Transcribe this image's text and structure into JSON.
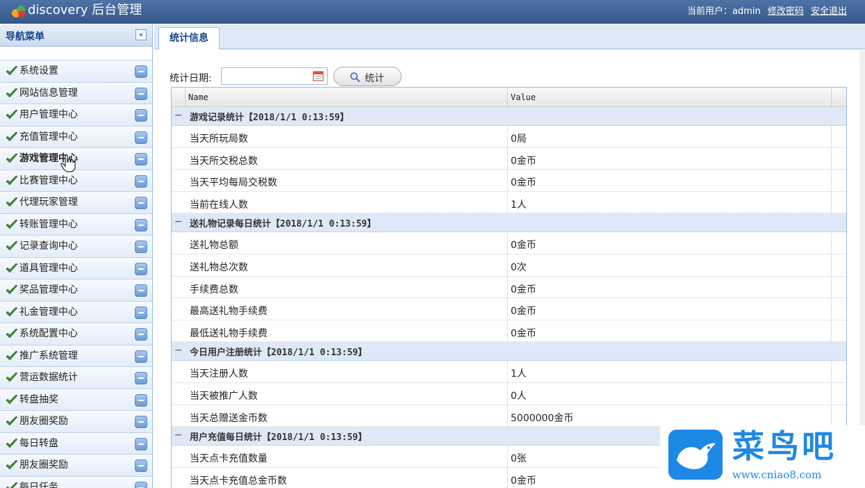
{
  "header": {
    "brand": "discovery 后台管理",
    "current_user_label": "当前用户：admin",
    "change_password": "修改密码",
    "logout": "安全退出"
  },
  "sidebar": {
    "title": "导航菜单",
    "collapse_glyph": "«",
    "items": [
      {
        "label": "系统设置"
      },
      {
        "label": "网站信息管理"
      },
      {
        "label": "用户管理中心"
      },
      {
        "label": "充值管理中心"
      },
      {
        "label": "游戏管理中心",
        "active": true
      },
      {
        "label": "比赛管理中心"
      },
      {
        "label": "代理玩家管理"
      },
      {
        "label": "转账管理中心"
      },
      {
        "label": "记录查询中心"
      },
      {
        "label": "道具管理中心"
      },
      {
        "label": "奖品管理中心"
      },
      {
        "label": "礼金管理中心"
      },
      {
        "label": "系统配置中心"
      },
      {
        "label": "推广系统管理"
      },
      {
        "label": "营运数据统计"
      },
      {
        "label": "转盘抽奖"
      },
      {
        "label": "朋友圈奖励"
      },
      {
        "label": "每日转盘"
      },
      {
        "label": "朋友圈奖励"
      },
      {
        "label": "每日任务"
      }
    ]
  },
  "tabs": [
    {
      "label": "统计信息"
    }
  ],
  "toolbar": {
    "date_label": "统计日期:",
    "date_value": "",
    "search_label": "统计"
  },
  "grid": {
    "columns": [
      "Name",
      "Value"
    ],
    "groups": [
      {
        "title": "游戏记录统计【2018/1/1 0:13:59】",
        "rows": [
          {
            "name": "当天所玩局数",
            "value": "0局"
          },
          {
            "name": "当天所交税总数",
            "value": "0金币"
          },
          {
            "name": "当天平均每局交税数",
            "value": "0金币"
          },
          {
            "name": "当前在线人数",
            "value": "1人"
          }
        ]
      },
      {
        "title": "送礼物记录每日统计【2018/1/1 0:13:59】",
        "rows": [
          {
            "name": "送礼物总额",
            "value": "0金币"
          },
          {
            "name": "送礼物总次数",
            "value": "0次"
          },
          {
            "name": "手续费总数",
            "value": "0金币"
          },
          {
            "name": "最高送礼物手续费",
            "value": "0金币"
          },
          {
            "name": "最低送礼物手续费",
            "value": "0金币"
          }
        ]
      },
      {
        "title": "今日用户注册统计【2018/1/1 0:13:59】",
        "rows": [
          {
            "name": "当天注册人数",
            "value": "1人"
          },
          {
            "name": "当天被推广人数",
            "value": "0人"
          },
          {
            "name": "当天总赠送金币数",
            "value": "5000000金币"
          }
        ]
      },
      {
        "title": "用户充值每日统计【2018/1/1 0:13:59】",
        "rows": [
          {
            "name": "当天点卡充值数量",
            "value": "0张"
          },
          {
            "name": "当天点卡充值总金币数",
            "value": "0金币"
          },
          {
            "name": "",
            "value": ""
          }
        ]
      }
    ]
  },
  "watermark": {
    "title": "菜鸟吧",
    "url": "www.cniao8.com"
  },
  "colors": {
    "header": "#3f639a",
    "accent": "#15428b",
    "group_bg": "#dfe8f6",
    "watermark": "#1e88e5"
  }
}
